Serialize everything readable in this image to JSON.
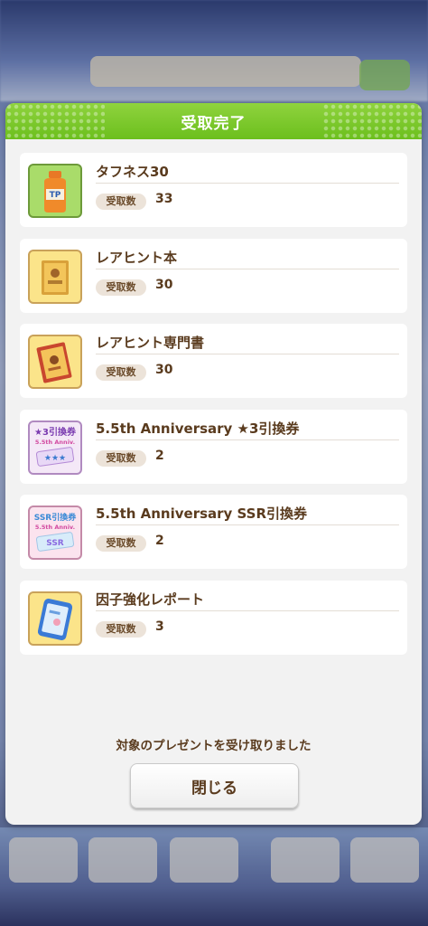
{
  "dialog": {
    "title": "受取完了",
    "qty_label": "受取数",
    "message": "対象のプレゼントを受け取りました",
    "close_label": "閉じる"
  },
  "items": [
    {
      "name": "タフネス30",
      "qty": "33",
      "icon": "toughness-drink-icon",
      "icon_text": "TP"
    },
    {
      "name": "レアヒント本",
      "qty": "30",
      "icon": "rare-hint-book-icon"
    },
    {
      "name": "レアヒント専門書",
      "qty": "30",
      "icon": "rare-hint-manual-icon"
    },
    {
      "name": "5.5th Anniversary ★3引換券",
      "qty": "2",
      "icon": "star3-ticket-icon",
      "icon_lines": [
        "★3引換券",
        "5.5th Anniv."
      ]
    },
    {
      "name": "5.5th Anniversary SSR引換券",
      "qty": "2",
      "icon": "ssr-ticket-icon",
      "icon_lines": [
        "SSR引換券",
        "5.5th Anniv.",
        "SSR"
      ]
    },
    {
      "name": "因子強化レポート",
      "qty": "3",
      "icon": "factor-report-tablet-icon"
    }
  ],
  "colors": {
    "header_green": "#7ac72a",
    "text_brown": "#5a3b1e",
    "badge_bg": "#ece3d9"
  }
}
